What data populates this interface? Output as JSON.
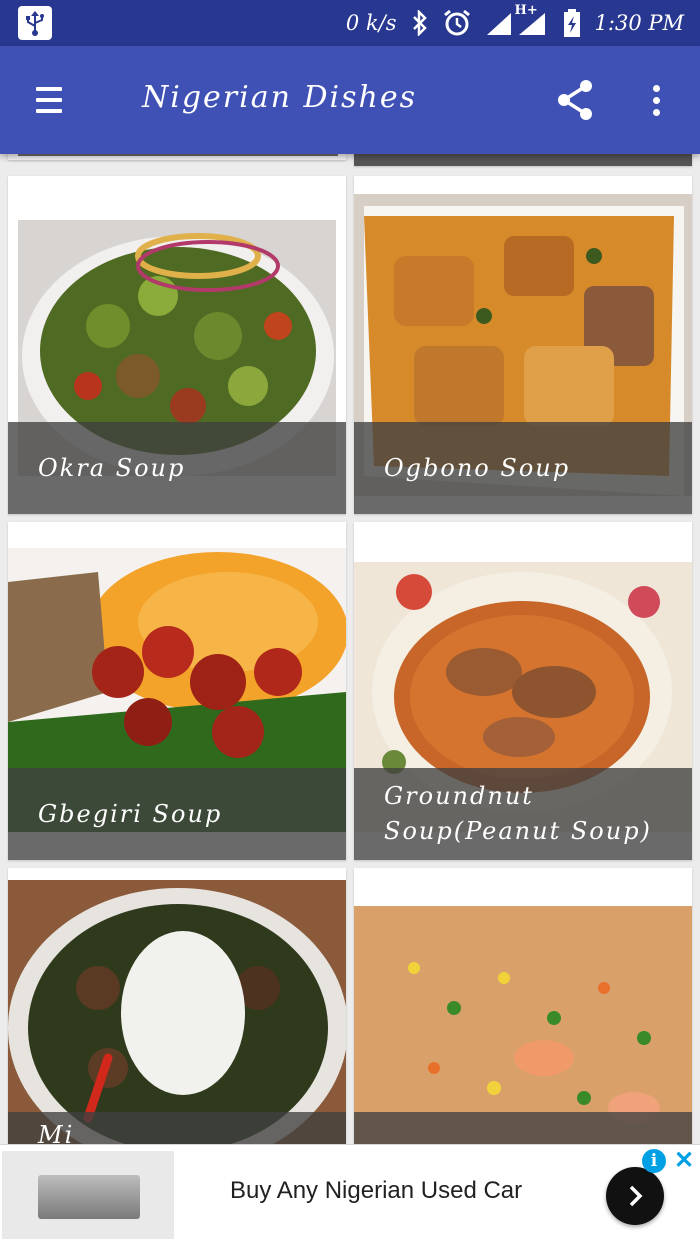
{
  "status_bar": {
    "net_speed": "0 k/s",
    "network": "H+",
    "time": "1:30 PM"
  },
  "app_bar": {
    "title": "Nigerian Dishes",
    "menu_icon": "hamburger-menu-icon",
    "share_icon": "share-icon",
    "more_icon": "more-vert-icon"
  },
  "dishes": [
    {
      "name": "Okra Soup"
    },
    {
      "name": "Ogbono Soup"
    },
    {
      "name": "Gbegiri Soup"
    },
    {
      "name": "Groundnut Soup(Peanut Soup)"
    },
    {
      "name": "Mi"
    },
    {
      "name": ""
    }
  ],
  "ad": {
    "text": "Buy Any Nigerian Used Car",
    "info_label": "i",
    "close_label": "✕"
  },
  "colors": {
    "status_bar": "#28378f",
    "app_bar": "#3f51b5",
    "caption_overlay": "#404040",
    "ad_info": "#00a0e4"
  }
}
